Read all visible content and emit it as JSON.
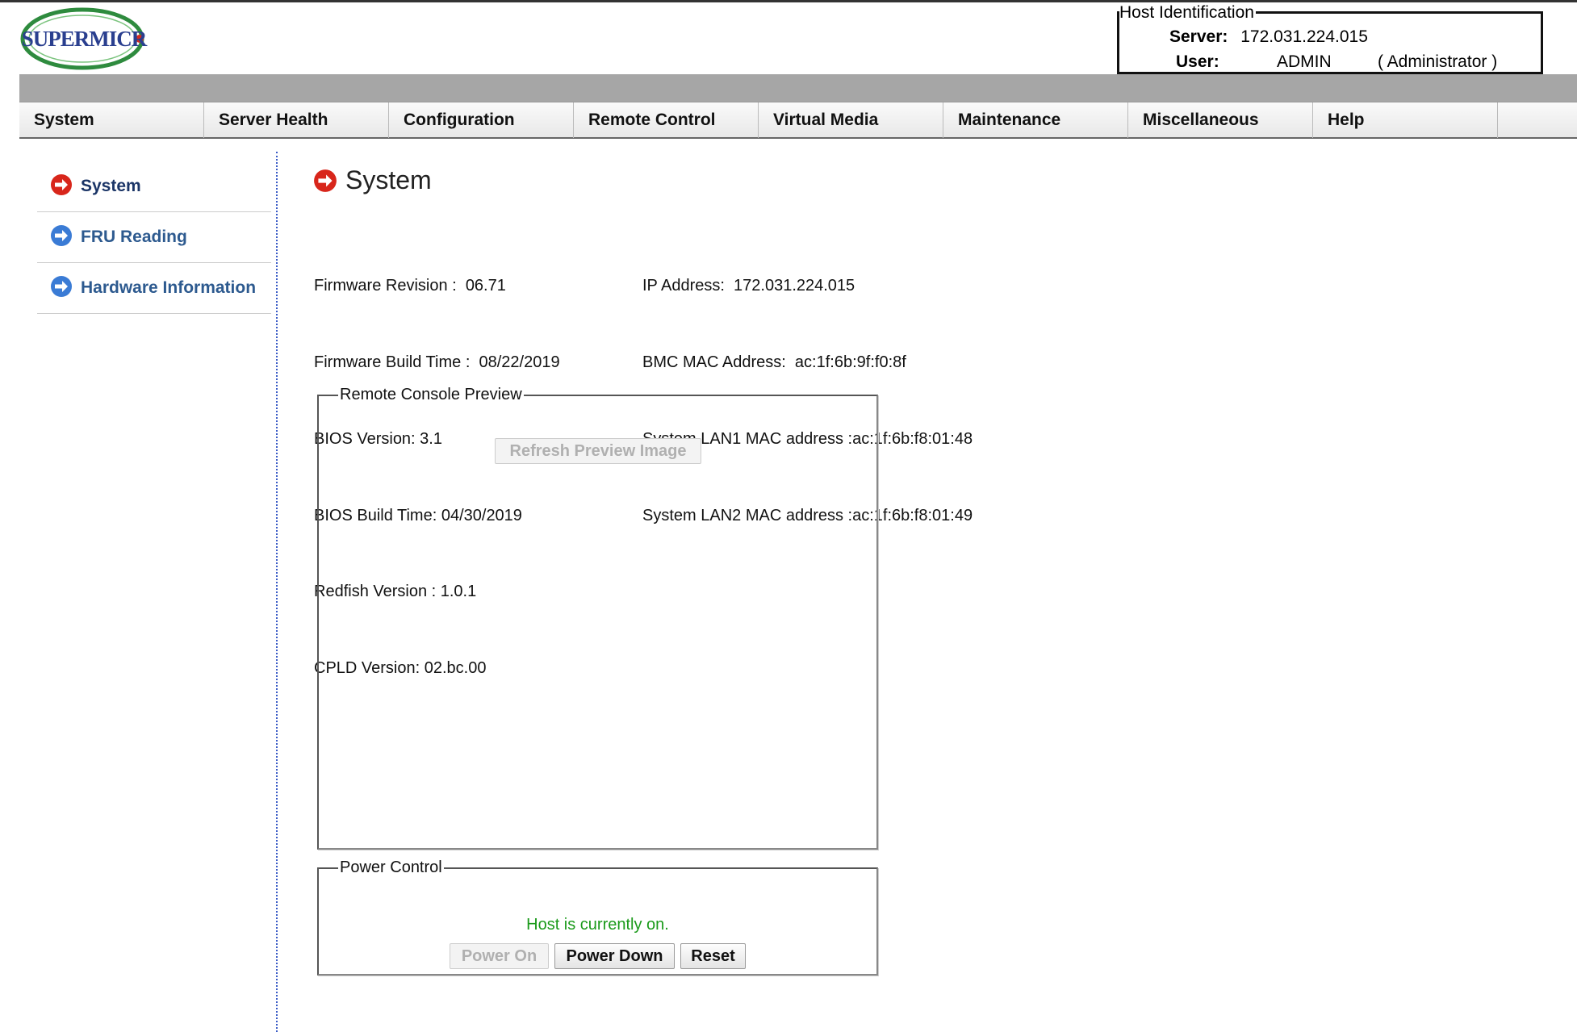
{
  "brand": {
    "logo_text": "SUPERMICR",
    "logo_icon": "supermicro-logo"
  },
  "host_identification": {
    "legend": "Host Identification",
    "server_label": "Server:",
    "server_value": "172.031.224.015",
    "user_label": "User:",
    "user_value": "ADMIN",
    "role": "( Administrator )"
  },
  "menu": [
    {
      "label": "System"
    },
    {
      "label": "Server Health"
    },
    {
      "label": "Configuration"
    },
    {
      "label": "Remote Control"
    },
    {
      "label": "Virtual Media"
    },
    {
      "label": "Maintenance"
    },
    {
      "label": "Miscellaneous"
    },
    {
      "label": "Help"
    }
  ],
  "sidebar": {
    "items": [
      {
        "label": "System",
        "icon": "red-arrow-icon",
        "active": true
      },
      {
        "label": "FRU Reading",
        "icon": "blue-arrow-icon"
      },
      {
        "label": "Hardware Information",
        "icon": "blue-arrow-icon"
      }
    ]
  },
  "page": {
    "title": "System",
    "title_icon": "red-arrow-icon",
    "left_info": [
      "Firmware Revision :  06.71",
      "Firmware Build Time :  08/22/2019",
      "BIOS Version: 3.1",
      "BIOS Build Time: 04/30/2019",
      "Redfish Version : 1.0.1",
      "CPLD Version: 02.bc.00"
    ],
    "right_info": [
      "IP Address:  172.031.224.015",
      "BMC MAC Address:  ac:1f:6b:9f:f0:8f",
      "System LAN1 MAC address :ac:1f:6b:f8:01:48",
      "System LAN2 MAC address :ac:1f:6b:f8:01:49"
    ]
  },
  "remote_console": {
    "legend": "Remote Console Preview",
    "refresh_button": "Refresh Preview Image"
  },
  "power_control": {
    "legend": "Power Control",
    "status": "Host is currently on.",
    "status_color": "#1a9a1a",
    "power_on_button": "Power On",
    "power_down_button": "Power Down",
    "reset_button": "Reset"
  }
}
